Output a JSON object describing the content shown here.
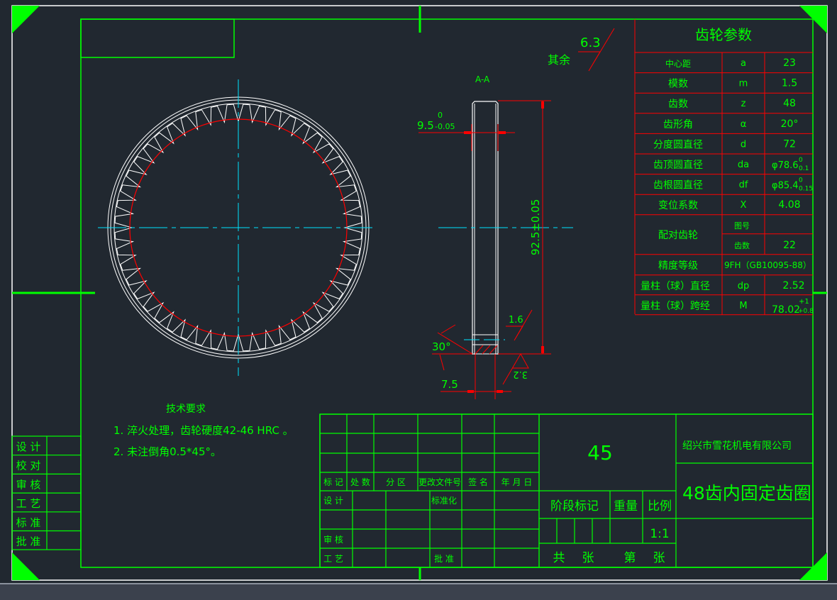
{
  "colors": {
    "background": "#212830",
    "frame": "#00ff00",
    "outline": "#ffffff",
    "dimension": "#ff0000",
    "centerline": "#00e5ff",
    "text": "#00ff00"
  },
  "section_view": {
    "label": "A-A",
    "width_dim": "9.5",
    "width_tol_upper": "0",
    "width_tol_lower": "-0.05",
    "height_dim": "92.5±0.05",
    "chamfer_angle": "30°",
    "bottom_dim": "7.5",
    "roughness_top": "1.6",
    "roughness_bottom": "3.2"
  },
  "surface_finish": {
    "label": "其余",
    "value": "6.3"
  },
  "gear_params": {
    "title": "齿轮参数",
    "rows": [
      {
        "name": "中心距",
        "symbol": "a",
        "value": "23"
      },
      {
        "name": "模数",
        "symbol": "m",
        "value": "1.5"
      },
      {
        "name": "齿数",
        "symbol": "z",
        "value": "48"
      },
      {
        "name": "齿形角",
        "symbol": "α",
        "value": "20°"
      },
      {
        "name": "分度圆直径",
        "symbol": "d",
        "value": "72"
      },
      {
        "name": "齿顶圆直径",
        "symbol": "da",
        "value": "φ78.6",
        "tol_upper": "0",
        "tol_lower": "0.1"
      },
      {
        "name": "齿根圆直径",
        "symbol": "df",
        "value": "φ85.4",
        "tol_upper": "0",
        "tol_lower": "0.15"
      },
      {
        "name": "变位系数",
        "symbol": "X",
        "value": "4.08"
      }
    ],
    "mating": {
      "name": "配对齿轮",
      "sub1": "图号",
      "sub1_value": "",
      "sub2": "齿数",
      "sub2_value": "22"
    },
    "accuracy": {
      "name": "精度等级",
      "value": "9FH（GB10095-88）"
    },
    "pin_dia": {
      "name": "量柱（球）直径",
      "symbol": "dp",
      "value": "2.52"
    },
    "pin_span": {
      "name": "量柱（球）跨经",
      "symbol": "M",
      "value": "78.02",
      "tol_upper": "+1",
      "tol_lower": "+0.8"
    }
  },
  "tech_requirements": {
    "title": "技术要求",
    "items": [
      "1. 淬火处理，齿轮硬度42-46 HRC 。",
      "2. 未注倒角0.5*45°。"
    ]
  },
  "side_table": [
    "设 计",
    "校 对",
    "审 核",
    "工 艺",
    "标 准",
    "批 准"
  ],
  "title_block": {
    "revision_headers": [
      "标 记",
      "处 数",
      "分 区",
      "更改文件号",
      "签 名",
      "年 月 日"
    ],
    "sign_rows": [
      "设 计",
      "",
      "审 核",
      "工 艺"
    ],
    "std_label": "标准化",
    "approve_label": "批 准",
    "material": "45",
    "stage_label": "阶段标记",
    "weight_label": "重量",
    "scale_label": "比例",
    "scale_value": "1:1",
    "sheets_total_label": "共",
    "sheets_unit1": "张",
    "sheet_no_label": "第",
    "sheets_unit2": "张",
    "company": "绍兴市雪花机电有限公司",
    "drawing_name": "48齿内固定齿圈"
  }
}
